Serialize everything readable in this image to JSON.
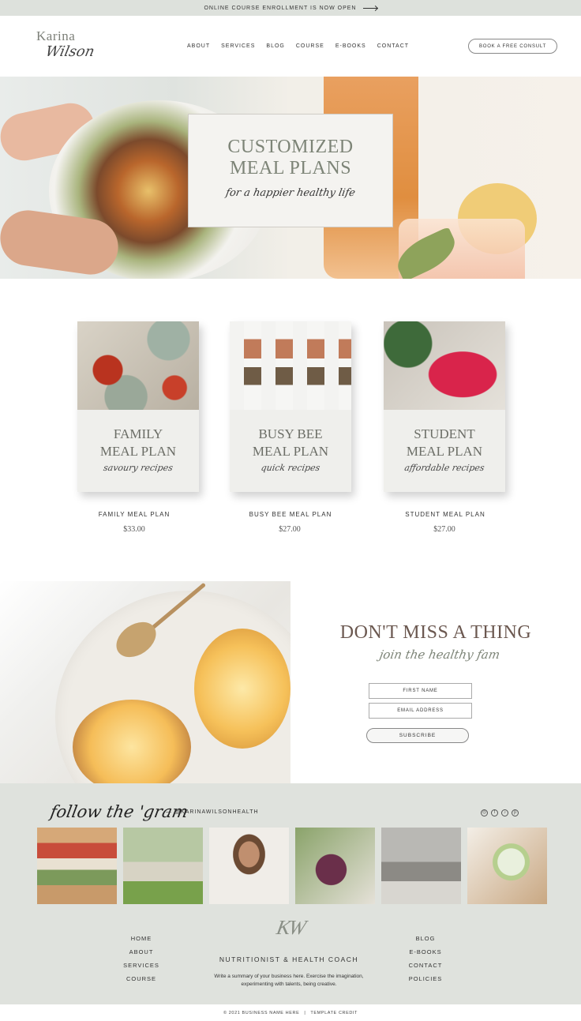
{
  "announcement": {
    "text": "ONLINE COURSE ENROLLMENT IS NOW OPEN"
  },
  "brand": {
    "first": "Karina",
    "last": "Wilson"
  },
  "nav": [
    "ABOUT",
    "SERVICES",
    "BLOG",
    "COURSE",
    "E-BOOKS",
    "CONTACT"
  ],
  "header": {
    "cta_label": "BOOK A FREE CONSULT"
  },
  "hero": {
    "title_line1": "CUSTOMIZED",
    "title_line2": "MEAL PLANS",
    "script": "for a happier healthy life"
  },
  "products": [
    {
      "book_line1": "FAMILY",
      "book_line2": "MEAL PLAN",
      "book_script": "savoury recipes",
      "name": "FAMILY MEAL PLAN",
      "price": "$33.00"
    },
    {
      "book_line1": "BUSY BEE",
      "book_line2": "MEAL PLAN",
      "book_script": "quick recipes",
      "name": "BUSY BEE MEAL PLAN",
      "price": "$27.00"
    },
    {
      "book_line1": "STUDENT",
      "book_line2": "MEAL PLAN",
      "book_script": "affordable recipes",
      "name": "STUDENT MEAL PLAN",
      "price": "$27.00"
    }
  ],
  "newsletter": {
    "title": "DON'T MISS A THING",
    "script": "join the healthy fam",
    "first_name_placeholder": "FIRST NAME",
    "email_placeholder": "EMAIL ADDRESS",
    "button": "SUBSCRIBE"
  },
  "instagram": {
    "script": "follow the 'gram",
    "handle": "— @KARINAWILSONHEALTH",
    "social_icons": [
      "instagram-icon",
      "facebook-icon",
      "tiktok-icon",
      "pinterest-icon"
    ]
  },
  "footer": {
    "left_links": [
      "HOME",
      "ABOUT",
      "SERVICES",
      "COURSE"
    ],
    "right_links": [
      "BLOG",
      "E-BOOKS",
      "CONTACT",
      "POLICIES"
    ],
    "monogram": "KW",
    "tagline": "NUTRITIONIST & HEALTH COACH",
    "summary": "Write a summary of your business here. Exercise the imagination, experimenting with talents, being creative.",
    "copyright": "© 2021 BUSINESS NAME HERE",
    "separator": "|",
    "credit": "TEMPLATE CREDIT"
  },
  "colors": {
    "accent_sage": "#7d8477",
    "footer_bg": "#dfe2dd",
    "announce_bg": "#dde1dc",
    "title_brown": "#6b5850"
  }
}
